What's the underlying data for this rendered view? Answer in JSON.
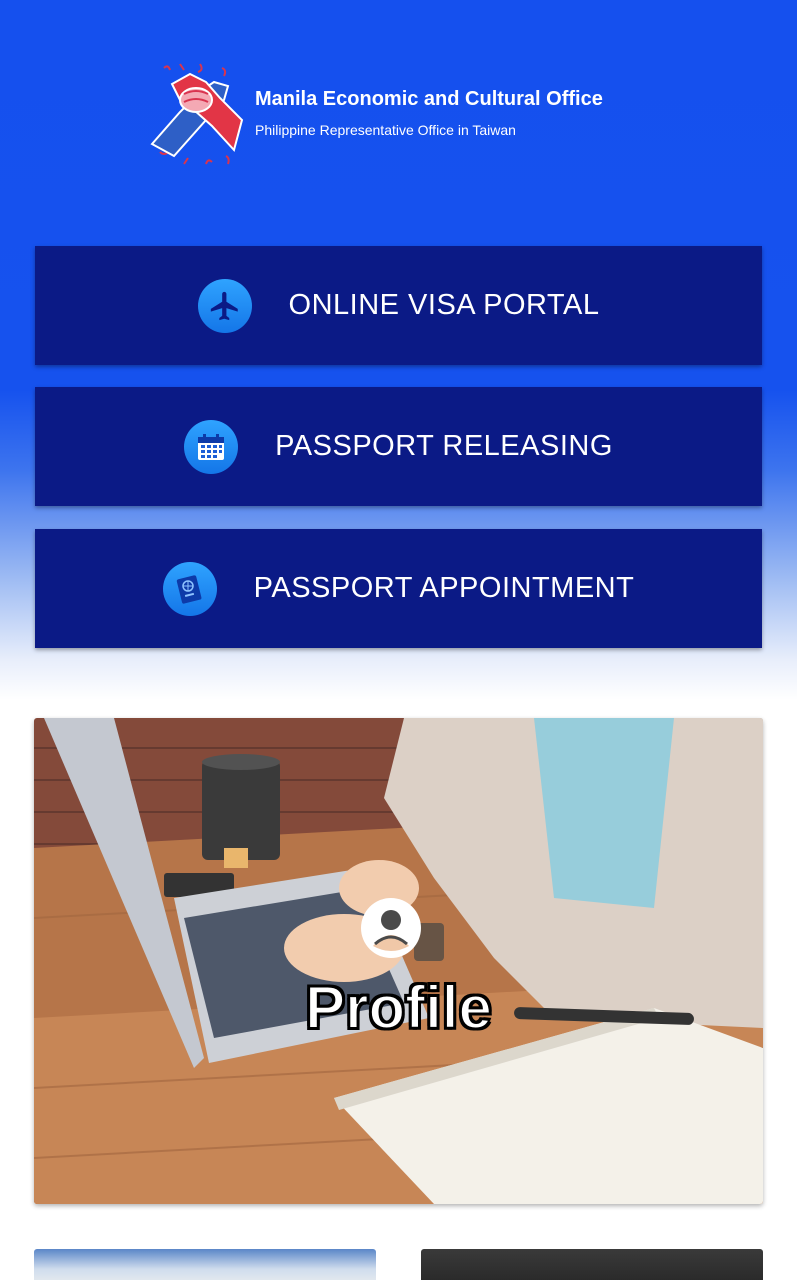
{
  "header": {
    "org_name": "Manila Economic and Cultural Office",
    "org_subtitle": "Philippine Representative Office in Taiwan",
    "logo_icon": "handshake-logo"
  },
  "menu": [
    {
      "label": "ONLINE VISA PORTAL",
      "icon": "airplane-icon"
    },
    {
      "label": "PASSPORT RELEASING",
      "icon": "calendar-icon"
    },
    {
      "label": "PASSPORT APPOINTMENT",
      "icon": "passport-icon"
    }
  ],
  "profile_card": {
    "label": "Profile",
    "icon": "user-avatar-icon"
  },
  "colors": {
    "background_top": "#1550ee",
    "button_bg": "#0b1a86",
    "icon_circle": "#1e8ff5",
    "text": "#ffffff"
  }
}
